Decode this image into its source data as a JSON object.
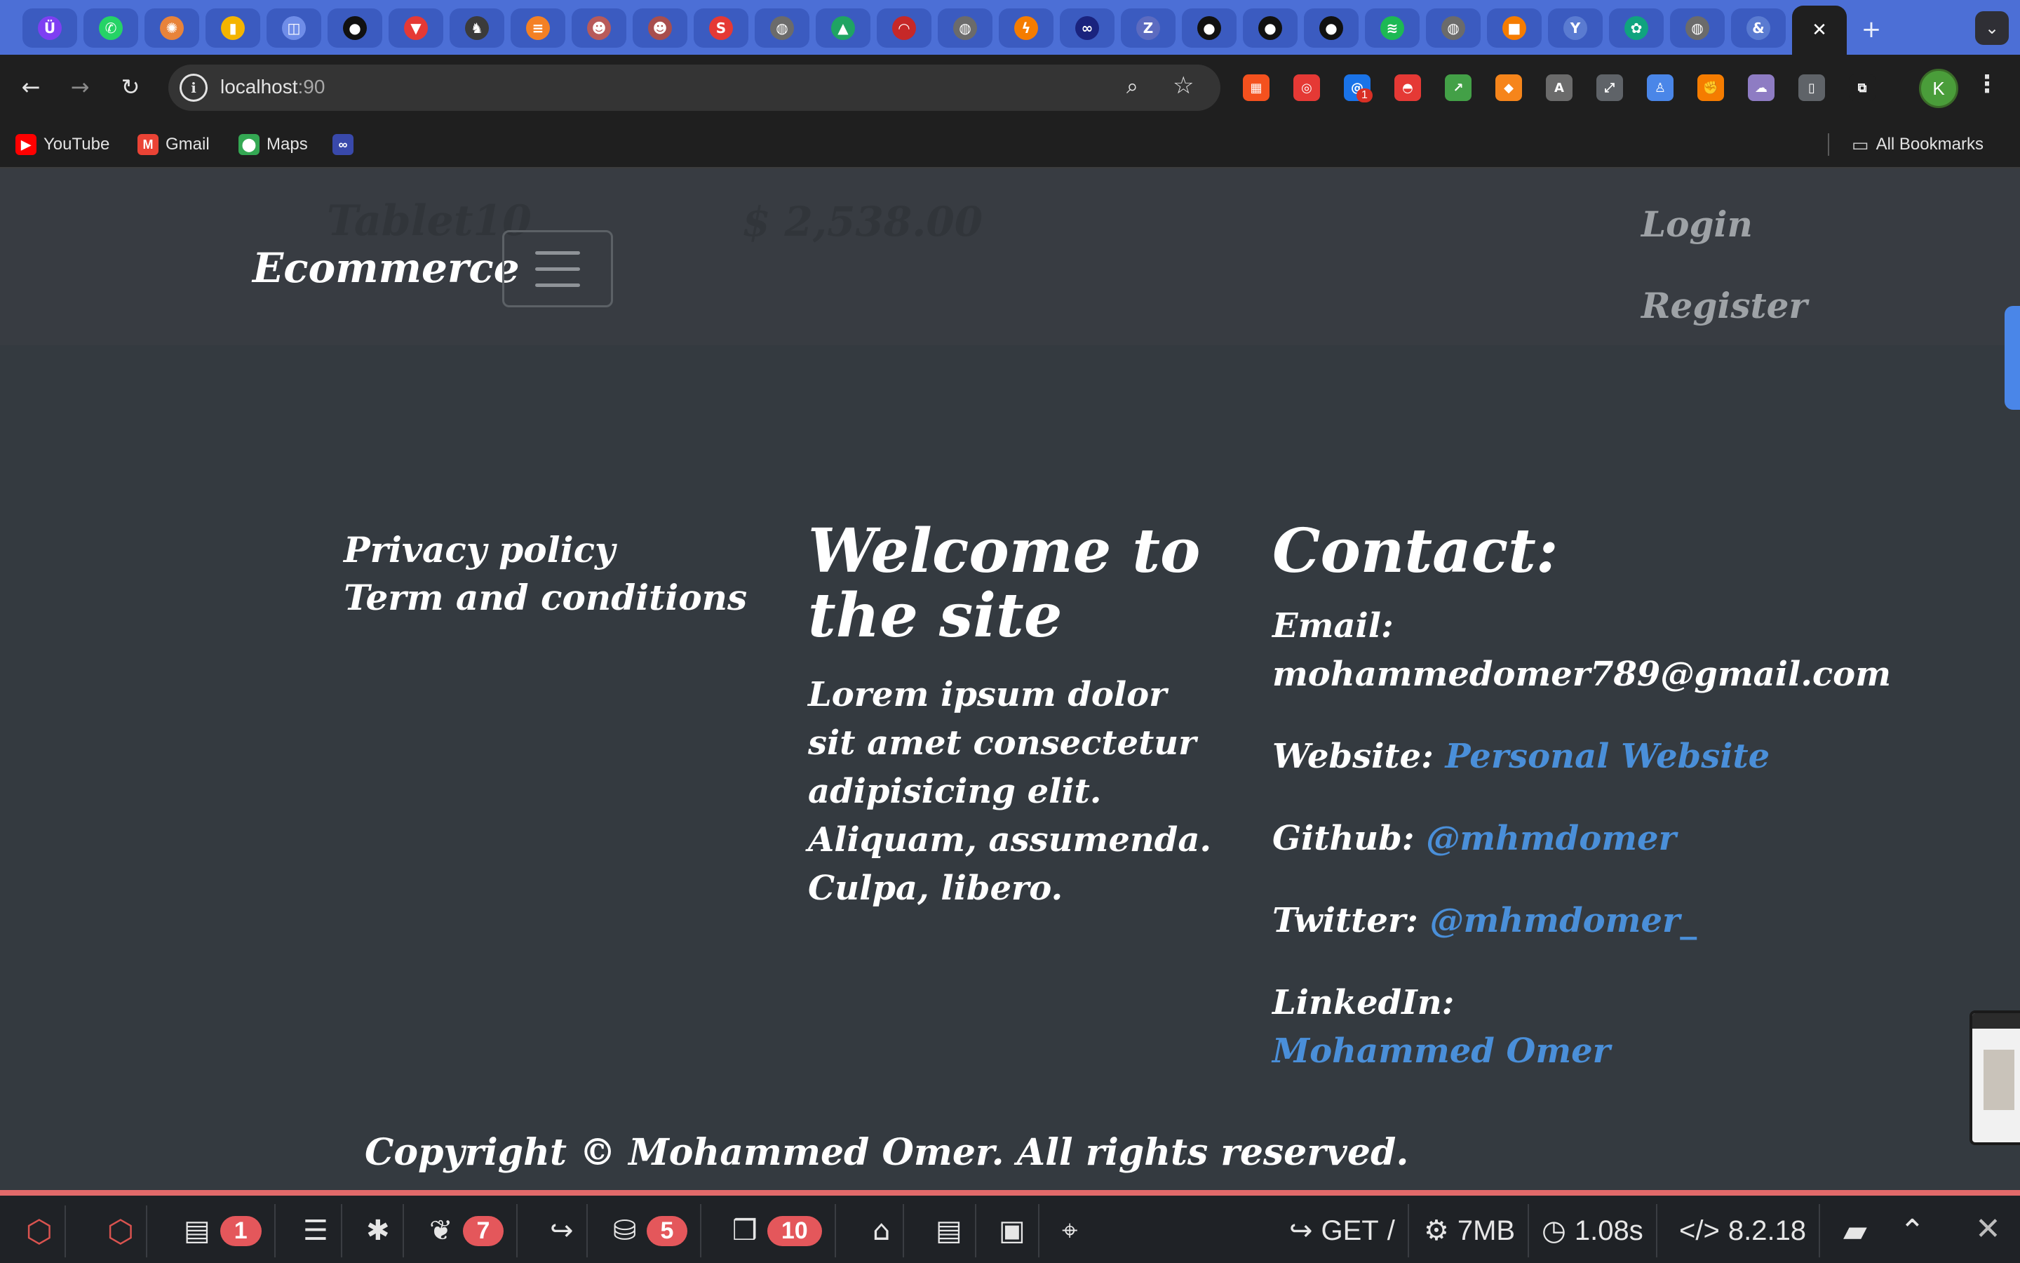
{
  "browser": {
    "tabs": [
      {
        "icon": "extension-u-icon",
        "glyph": "Ü",
        "color": "#7e3ff2"
      },
      {
        "icon": "whatsapp-icon",
        "glyph": "✆",
        "color": "#25d366"
      },
      {
        "icon": "sunburst-icon",
        "glyph": "✺",
        "color": "#e8833a"
      },
      {
        "icon": "keep-notes-icon",
        "glyph": "▮",
        "color": "#f4b400"
      },
      {
        "icon": "analytics-icon",
        "glyph": "◫",
        "color": "#6f8de8"
      },
      {
        "icon": "github-icon",
        "glyph": "●",
        "color": "#111111"
      },
      {
        "icon": "vite-icon",
        "glyph": "▼",
        "color": "#e53935"
      },
      {
        "icon": "elephant-icon",
        "glyph": "♞",
        "color": "#3b3b3b"
      },
      {
        "icon": "stackoverflow-icon",
        "glyph": "≡",
        "color": "#f48024"
      },
      {
        "icon": "profile-photo-icon",
        "glyph": "☻",
        "color": "#b85a5a"
      },
      {
        "icon": "profile-photo-icon",
        "glyph": "☻",
        "color": "#a84e4e"
      },
      {
        "icon": "s-logo-icon",
        "glyph": "S",
        "color": "#e53935"
      },
      {
        "icon": "globe-icon",
        "glyph": "◍",
        "color": "#6b6b6b"
      },
      {
        "icon": "google-drive-icon",
        "glyph": "▲",
        "color": "#1fa463"
      },
      {
        "icon": "speedometer-icon",
        "glyph": "◠",
        "color": "#c62828"
      },
      {
        "icon": "globe-icon",
        "glyph": "◍",
        "color": "#6b6b6b"
      },
      {
        "icon": "bolt-icon",
        "glyph": "ϟ",
        "color": "#f57c00"
      },
      {
        "icon": "link-icon",
        "glyph": "∞",
        "color": "#1a237e"
      },
      {
        "icon": "zotero-icon",
        "glyph": "Z",
        "color": "#5c6bc0"
      },
      {
        "icon": "github-icon",
        "glyph": "●",
        "color": "#111111"
      },
      {
        "icon": "github-icon",
        "glyph": "●",
        "color": "#111111"
      },
      {
        "icon": "github-icon",
        "glyph": "●",
        "color": "#111111"
      },
      {
        "icon": "spotify-icon",
        "glyph": "≋",
        "color": "#1db954"
      },
      {
        "icon": "globe-icon",
        "glyph": "◍",
        "color": "#6b6b6b"
      },
      {
        "icon": "cube-icon",
        "glyph": "■",
        "color": "#f57c00"
      },
      {
        "icon": "y-combinator-icon",
        "glyph": "Y",
        "color": "#5a7bd1"
      },
      {
        "icon": "openai-icon",
        "glyph": "✿",
        "color": "#10a37f"
      },
      {
        "icon": "globe-icon",
        "glyph": "◍",
        "color": "#6b6b6b"
      },
      {
        "icon": "ampersand-icon",
        "glyph": "&",
        "color": "#5a7bd1"
      },
      {
        "icon": "close-tab-icon",
        "glyph": "✕",
        "color": "#1f1f1f",
        "active": true
      }
    ],
    "url_host": "localhost",
    "url_port": ":90",
    "extensions": [
      {
        "icon": "extension-layout-icon",
        "glyph": "▦",
        "color": "#f4511e"
      },
      {
        "icon": "extension-search-icon",
        "glyph": "◎",
        "color": "#e53935"
      },
      {
        "icon": "extension-at-icon",
        "glyph": "@",
        "color": "#1a73e8"
      },
      {
        "icon": "pokeball-icon",
        "glyph": "◓",
        "color": "#e53935"
      },
      {
        "icon": "chart-growth-icon",
        "glyph": "↗",
        "color": "#43a047"
      },
      {
        "icon": "metamask-fox-icon",
        "glyph": "◆",
        "color": "#f6851b"
      },
      {
        "icon": "extension-a-icon",
        "glyph": "A",
        "color": "#6b6b6b"
      },
      {
        "icon": "fullscreen-icon",
        "glyph": "⤢",
        "color": "#5f6368"
      },
      {
        "icon": "extension-person-icon",
        "glyph": "♙",
        "color": "#4a86e8"
      },
      {
        "icon": "fist-icon",
        "glyph": "✊",
        "color": "#f57c00"
      },
      {
        "icon": "ghost-icon",
        "glyph": "☁",
        "color": "#8e7cc3"
      },
      {
        "icon": "mouse-icon",
        "glyph": "▯",
        "color": "#5f6368"
      },
      {
        "icon": "puzzle-icon",
        "glyph": "⧉",
        "color": "#1f1f1f"
      }
    ],
    "extension_badge": "1",
    "profile_initial": "K",
    "bookmarks": [
      {
        "label": "YouTube",
        "icon": "youtube-icon",
        "glyph": "▶",
        "color": "#ff0000"
      },
      {
        "label": "Gmail",
        "icon": "gmail-icon",
        "glyph": "M",
        "color": "#ea4335"
      },
      {
        "label": "Maps",
        "icon": "maps-pin-icon",
        "glyph": "⬤",
        "color": "#34a853"
      },
      {
        "label": "",
        "icon": "link-icon",
        "glyph": "∞",
        "color": "#3949ab"
      }
    ],
    "all_bookmarks": "All Bookmarks"
  },
  "page": {
    "ghost_product_name": "Tablet10",
    "ghost_product_price": "$ 2,538.00",
    "brand": "Ecommerce",
    "nav": {
      "login": "Login",
      "register": "Register"
    },
    "footer_links": [
      "Privacy policy",
      "Term and conditions"
    ],
    "welcome_title": "Welcome to the site",
    "welcome_text": "Lorem ipsum dolor sit amet consectetur adipisicing elit. Aliquam, assumenda. Culpa, libero.",
    "contact": {
      "title": "Contact:",
      "email_label": "Email:",
      "email_value": "mohammedomer789@gmail.com",
      "website_label": "Website:",
      "website_value": "Personal Website",
      "github_label": "Github:",
      "github_value": "@mhmdomer",
      "twitter_label": "Twitter:",
      "twitter_value": "@mhmdomer_",
      "linkedin_label": "LinkedIn:",
      "linkedin_value": "Mohammed Omer"
    },
    "footer_partial": "Copyright © Mohammed Omer. All rights reserved."
  },
  "debugbar": {
    "messages_count": "1",
    "views_count": "7",
    "queries_count": "5",
    "models_count": "10",
    "method": "GET",
    "route": "/",
    "memory": "7MB",
    "duration": "1.08s",
    "php_version": "8.2.18"
  },
  "colors": {
    "link": "#4a8fd9",
    "debug_badge": "#e4575b",
    "tabstrip": "#4c6fd6"
  }
}
